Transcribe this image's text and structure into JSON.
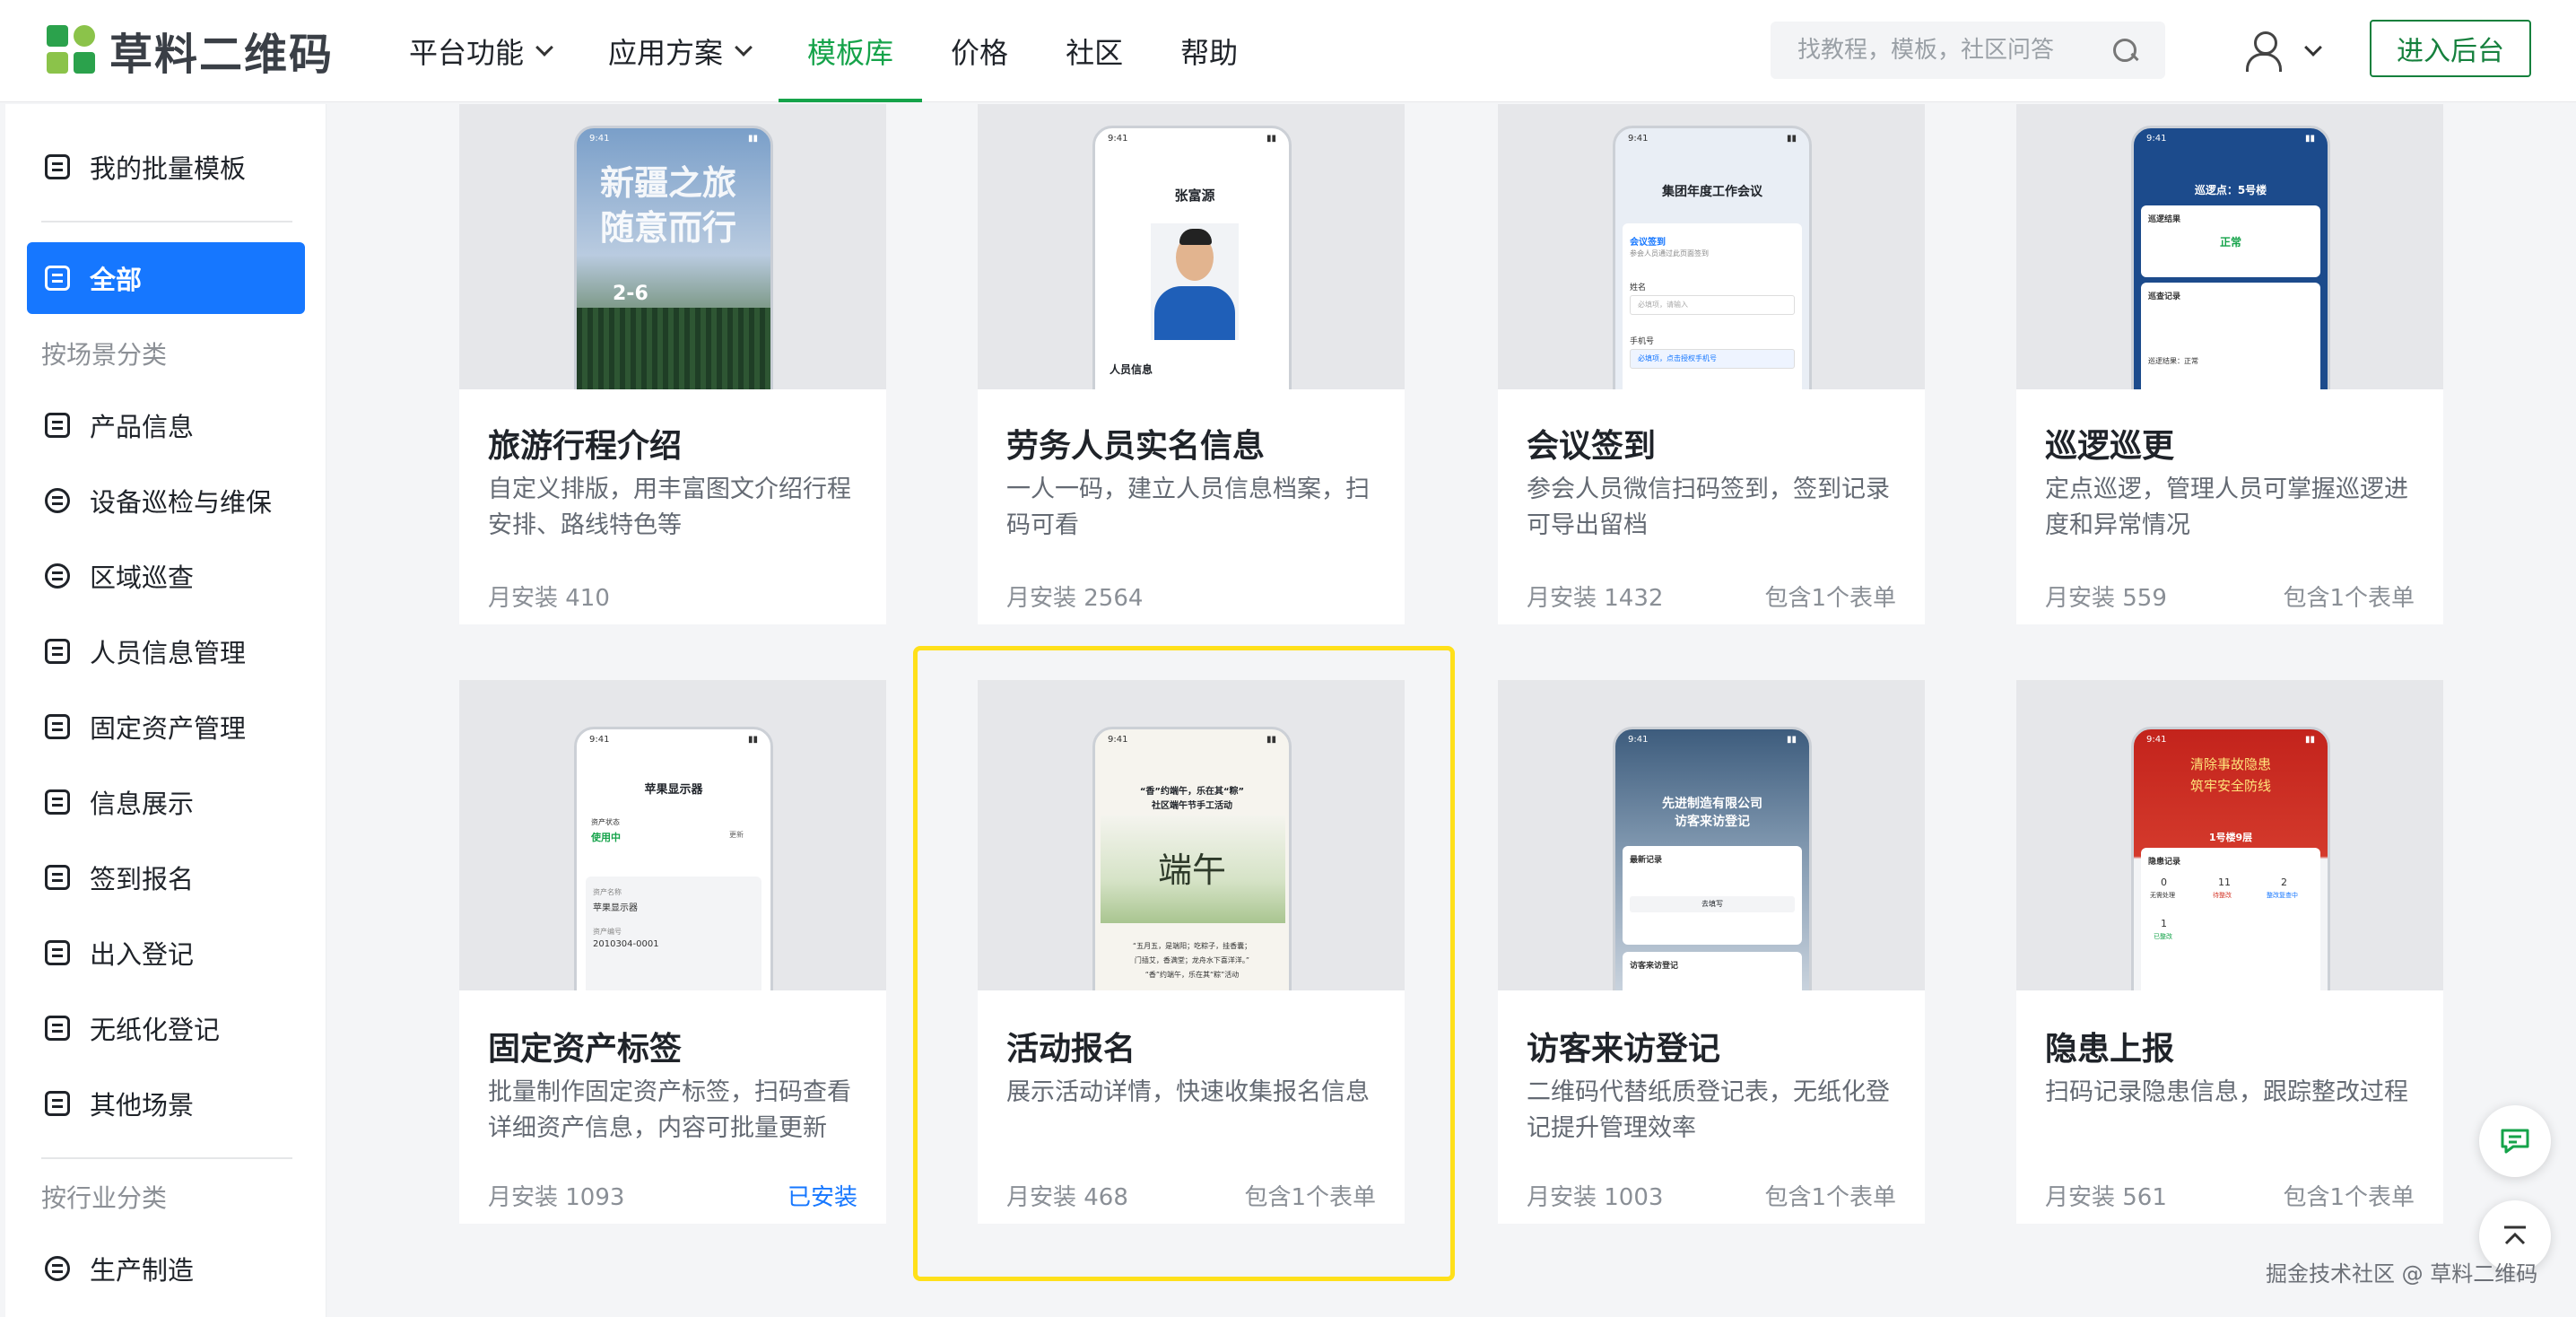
{
  "header": {
    "logo_text": "草料二维码",
    "nav": [
      {
        "label": "平台功能",
        "dropdown": true,
        "active": false
      },
      {
        "label": "应用方案",
        "dropdown": true,
        "active": false
      },
      {
        "label": "模板库",
        "dropdown": false,
        "active": true
      },
      {
        "label": "价格",
        "dropdown": false,
        "active": false
      },
      {
        "label": "社区",
        "dropdown": false,
        "active": false
      },
      {
        "label": "帮助",
        "dropdown": false,
        "active": false
      }
    ],
    "search_placeholder": "找教程，模板，社区问答",
    "enter_button": "进入后台",
    "accent": "#15a34a"
  },
  "sidebar": {
    "my_templates": "我的批量模板",
    "all": "全部",
    "group_scene": "按场景分类",
    "scene_items": [
      "产品信息",
      "设备巡检与维保",
      "区域巡查",
      "人员信息管理",
      "固定资产管理",
      "信息展示",
      "签到报名",
      "出入登记",
      "无纸化登记",
      "其他场景"
    ],
    "group_industry": "按行业分类",
    "industry_items": [
      "生产制造"
    ],
    "active_color": "#1677ff"
  },
  "cards": [
    {
      "title": "旅游行程介绍",
      "desc": "自定义排版，用丰富图文介绍行程安排、路线特色等",
      "installs": "月安装 410",
      "extra": "",
      "thumb": {
        "time": "9:41",
        "headline1": "新疆之旅",
        "headline2": "随意而行",
        "badge": "2-6"
      }
    },
    {
      "title": "劳务人员实名信息",
      "desc": "一人一码，建立人员信息档案，扫码可看",
      "installs": "月安装 2564",
      "extra": "",
      "thumb": {
        "time": "9:41",
        "name": "张富源",
        "label": "人员信息"
      }
    },
    {
      "title": "会议签到",
      "desc": "参会人员微信扫码签到，签到记录可导出留档",
      "installs": "月安装 1432",
      "extra": "包含1个表单",
      "thumb": {
        "time": "9:41",
        "heading": "集团年度工作会议",
        "sub": "会议签到",
        "note": "参会人员通过此页面签到",
        "f1": "姓名",
        "p1": "必填项，请输入",
        "f2": "手机号",
        "p2": "必填项，点击授权手机号"
      }
    },
    {
      "title": "巡逻巡更",
      "desc": "定点巡逻，管理人员可掌握巡逻进度和异常情况",
      "installs": "月安装 559",
      "extra": "包含1个表单",
      "thumb": {
        "time": "9:41",
        "heading": "巡逻点：5号楼",
        "r1": "巡逻结果",
        "status": "正常",
        "r2": "巡查记录",
        "r3": "巡逻结果：正常"
      }
    },
    {
      "title": "固定资产标签",
      "desc": "批量制作固定资产标签，扫码查看详细资产信息，内容可批量更新",
      "installs": "月安装 1093",
      "extra": "已安装",
      "thumb": {
        "time": "9:41",
        "heading": "苹果显示器",
        "s1": "资产状态",
        "s2": "使用中",
        "s3": "更新",
        "l1": "资产名称",
        "v1": "苹果显示器",
        "l2": "资产编号",
        "v2": "2010304-0001"
      }
    },
    {
      "title": "活动报名",
      "desc": "展示活动详情，快速收集报名信息",
      "installs": "月安装 468",
      "extra": "包含1个表单",
      "thumb": {
        "time": "9:41",
        "h1": "“香”约端午，乐在其“粽”",
        "h2": "社区端午节手工活动",
        "art": "端午",
        "p1": "“五月五，是端阳；吃粽子，挂香囊；",
        "p2": "门插艾，香满堂；龙舟水下喜洋洋。”",
        "p3": "“香”约端午，乐在其“粽”活动"
      }
    },
    {
      "title": "访客来访登记",
      "desc": "二维码代替纸质登记表，无纸化登记提升管理效率",
      "installs": "月安装 1003",
      "extra": "包含1个表单",
      "thumb": {
        "time": "9:41",
        "h1": "先进制造有限公司",
        "h2": "访客来访登记",
        "s1": "最新记录",
        "btn": "去填写",
        "s2": "访客来访登记"
      }
    },
    {
      "title": "隐患上报",
      "desc": "扫码记录隐患信息，跟踪整改过程",
      "installs": "月安装 561",
      "extra": "包含1个表单",
      "thumb": {
        "time": "9:41",
        "h1": "清除事故隐患",
        "h2": "筑牢安全防线",
        "loc": "1号楼9层",
        "s1": "隐患记录",
        "n1": "0",
        "l1": "无需处理",
        "n2": "11",
        "l2": "待整改",
        "n3": "2",
        "l3": "整改复查中",
        "n4": "1",
        "l4": "已整改"
      }
    }
  ],
  "watermark": "掘金技术社区 @ 草料二维码"
}
